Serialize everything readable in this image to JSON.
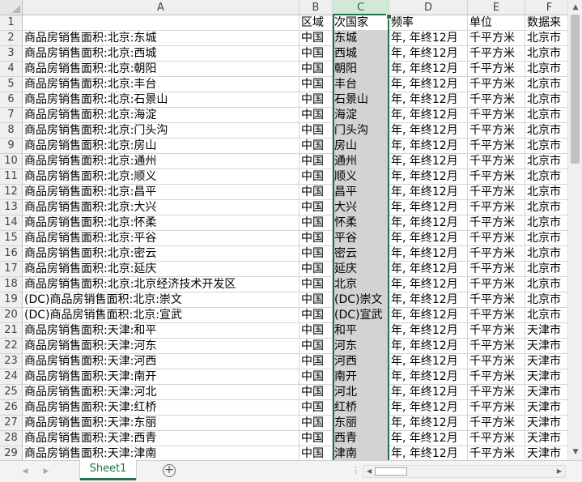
{
  "columns": [
    "A",
    "B",
    "C",
    "D",
    "E",
    "F"
  ],
  "selected_column": "C",
  "header_row": [
    "",
    "区域",
    "次国家",
    "频率",
    "单位",
    "数据来"
  ],
  "rows": [
    [
      "商品房销售面积:北京:东城",
      "中国",
      "东城",
      "年, 年终12月",
      "千平方米",
      "北京市"
    ],
    [
      "商品房销售面积:北京:西城",
      "中国",
      "西城",
      "年, 年终12月",
      "千平方米",
      "北京市"
    ],
    [
      "商品房销售面积:北京:朝阳",
      "中国",
      "朝阳",
      "年, 年终12月",
      "千平方米",
      "北京市"
    ],
    [
      "商品房销售面积:北京:丰台",
      "中国",
      "丰台",
      "年, 年终12月",
      "千平方米",
      "北京市"
    ],
    [
      "商品房销售面积:北京:石景山",
      "中国",
      "石景山",
      "年, 年终12月",
      "千平方米",
      "北京市"
    ],
    [
      "商品房销售面积:北京:海淀",
      "中国",
      "海淀",
      "年, 年终12月",
      "千平方米",
      "北京市"
    ],
    [
      "商品房销售面积:北京:门头沟",
      "中国",
      "门头沟",
      "年, 年终12月",
      "千平方米",
      "北京市"
    ],
    [
      "商品房销售面积:北京:房山",
      "中国",
      "房山",
      "年, 年终12月",
      "千平方米",
      "北京市"
    ],
    [
      "商品房销售面积:北京:通州",
      "中国",
      "通州",
      "年, 年终12月",
      "千平方米",
      "北京市"
    ],
    [
      "商品房销售面积:北京:顺义",
      "中国",
      "顺义",
      "年, 年终12月",
      "千平方米",
      "北京市"
    ],
    [
      "商品房销售面积:北京:昌平",
      "中国",
      "昌平",
      "年, 年终12月",
      "千平方米",
      "北京市"
    ],
    [
      "商品房销售面积:北京:大兴",
      "中国",
      "大兴",
      "年, 年终12月",
      "千平方米",
      "北京市"
    ],
    [
      "商品房销售面积:北京:怀柔",
      "中国",
      "怀柔",
      "年, 年终12月",
      "千平方米",
      "北京市"
    ],
    [
      "商品房销售面积:北京:平谷",
      "中国",
      "平谷",
      "年, 年终12月",
      "千平方米",
      "北京市"
    ],
    [
      "商品房销售面积:北京:密云",
      "中国",
      "密云",
      "年, 年终12月",
      "千平方米",
      "北京市"
    ],
    [
      "商品房销售面积:北京:延庆",
      "中国",
      "延庆",
      "年, 年终12月",
      "千平方米",
      "北京市"
    ],
    [
      "商品房销售面积:北京:北京经济技术开发区",
      "中国",
      "北京",
      "年, 年终12月",
      "千平方米",
      "北京市"
    ],
    [
      "(DC)商品房销售面积:北京:崇文",
      "中国",
      "(DC)崇文",
      "年, 年终12月",
      "千平方米",
      "北京市"
    ],
    [
      "(DC)商品房销售面积:北京:宣武",
      "中国",
      "(DC)宣武",
      "年, 年终12月",
      "千平方米",
      "北京市"
    ],
    [
      "商品房销售面积:天津:和平",
      "中国",
      "和平",
      "年, 年终12月",
      "千平方米",
      "天津市"
    ],
    [
      "商品房销售面积:天津:河东",
      "中国",
      "河东",
      "年, 年终12月",
      "千平方米",
      "天津市"
    ],
    [
      "商品房销售面积:天津:河西",
      "中国",
      "河西",
      "年, 年终12月",
      "千平方米",
      "天津市"
    ],
    [
      "商品房销售面积:天津:南开",
      "中国",
      "南开",
      "年, 年终12月",
      "千平方米",
      "天津市"
    ],
    [
      "商品房销售面积:天津:河北",
      "中国",
      "河北",
      "年, 年终12月",
      "千平方米",
      "天津市"
    ],
    [
      "商品房销售面积:天津:红桥",
      "中国",
      "红桥",
      "年, 年终12月",
      "千平方米",
      "天津市"
    ],
    [
      "商品房销售面积:天津:东丽",
      "中国",
      "东丽",
      "年, 年终12月",
      "千平方米",
      "天津市"
    ],
    [
      "商品房销售面积:天津:西青",
      "中国",
      "西青",
      "年, 年终12月",
      "千平方米",
      "天津市"
    ],
    [
      "商品房销售面积:天津:津南",
      "中国",
      "津南",
      "年, 年终12月",
      "千平方米",
      "天津市"
    ]
  ],
  "sheet_tab": "Sheet1",
  "add_sheet_symbol": "+",
  "colors": {
    "accent": "#217346",
    "selection_fill": "#d3d3d3",
    "header_bg": "#efefef"
  },
  "icons": {
    "nav_prev": "nav-left-icon",
    "nav_next": "nav-right-icon",
    "add_sheet": "plus-circle-icon",
    "scroll_up": "triangle-up-icon",
    "scroll_down": "triangle-down-icon",
    "scroll_left": "triangle-left-icon",
    "scroll_right": "triangle-right-icon"
  }
}
